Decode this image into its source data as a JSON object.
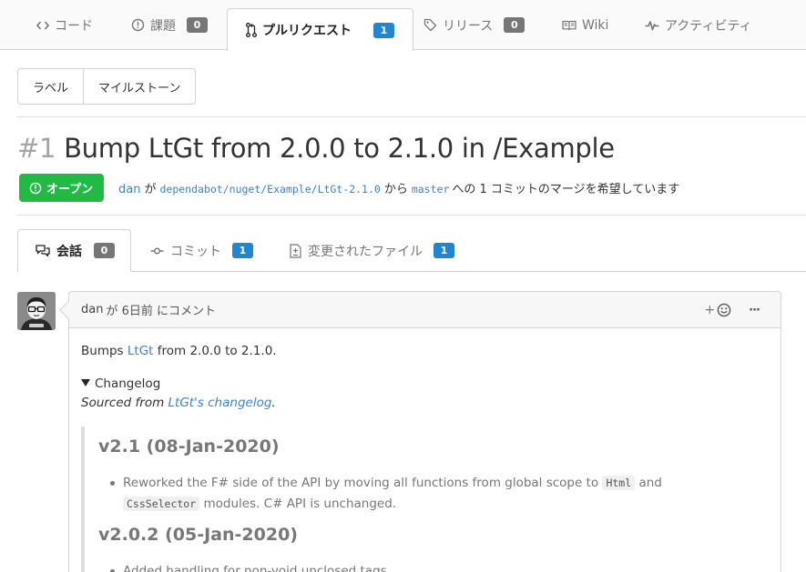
{
  "repo_tabs": {
    "code": {
      "label": "コード"
    },
    "issues": {
      "label": "課題",
      "count": "0"
    },
    "pulls": {
      "label": "プルリクエスト",
      "count": "1"
    },
    "releases": {
      "label": "リリース",
      "count": "0"
    },
    "wiki": {
      "label": "Wiki"
    },
    "activity": {
      "label": "アクティビティ"
    }
  },
  "filters": {
    "labels": "ラベル",
    "milestones": "マイルストーン"
  },
  "pr": {
    "index": "#1",
    "title": "Bump LtGt from 2.0.0 to 2.1.0 in /Example",
    "state": "オープン",
    "author": "dan",
    "particle_ga": "が",
    "head_branch": "dependabot/nuget/Example/LtGt-2.1.0",
    "particle_kara": "から",
    "base_branch": "master",
    "merge_text": "への 1 コミットのマージを希望しています"
  },
  "pr_tabs": {
    "conversation": {
      "label": "会話",
      "count": "0"
    },
    "commits": {
      "label": "コミット",
      "count": "1"
    },
    "files": {
      "label": "変更されたファイル",
      "count": "1"
    }
  },
  "comment": {
    "author": "dan",
    "header_rest": "が 6日前 にコメント",
    "add_reaction": "+",
    "more": "···",
    "body": {
      "bumps_prefix": "Bumps ",
      "bumps_link": "LtGt",
      "bumps_suffix": " from 2.0.0 to 2.1.0.",
      "summary": "Changelog",
      "sourced_prefix": "Sourced from ",
      "sourced_link": "LtGt's changelog",
      "sourced_suffix": ".",
      "v1_heading": "v2.1 (08-Jan-2020)",
      "v1_item_a": "Reworked the F# side of the API by moving all functions from global scope to ",
      "v1_code_a": "Html",
      "v1_item_b": " and ",
      "v1_code_b": "CssSelector",
      "v1_item_c": " modules. C# API is unchanged.",
      "v2_heading": "v2.0.2 (05-Jan-2020)",
      "v2_item": "Added handling for non-void unclosed tags"
    }
  },
  "colors": {
    "open_green": "#21ba45",
    "link_blue": "#4183c4",
    "badge_blue": "#2185d0",
    "badge_grey": "#767676"
  }
}
